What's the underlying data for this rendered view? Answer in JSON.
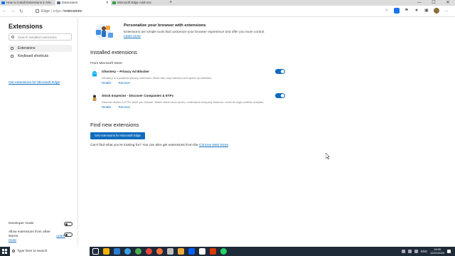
{
  "browser": {
    "tabs": [
      {
        "title": "How to install Extensions in Mic..."
      },
      {
        "title": "Extensions"
      },
      {
        "title": "Microsoft Edge Add-ons"
      }
    ],
    "new_tab_label": "+",
    "window_controls": {
      "minimize": "—",
      "maximize": "☐",
      "close": "✕"
    },
    "address": {
      "prefix": "Edge",
      "separator": "|",
      "scheme": "edge://",
      "path": "extensions"
    }
  },
  "sidebar": {
    "title": "Extensions",
    "search_placeholder": "Search installed extensions",
    "items": [
      {
        "label": "Extensions",
        "icon": "puzzle-icon",
        "active": true
      },
      {
        "label": "Keyboard shortcuts",
        "icon": "keyboard-icon",
        "active": false
      }
    ],
    "get_link": "Get extensions for Microsoft Edge",
    "developer_mode_label": "Developer mode",
    "allow_other_stores_label": "Allow extensions from other stores.",
    "learn_more": "Learn more"
  },
  "main": {
    "hero": {
      "title": "Personalize your browser with extensions",
      "description": "Extensions are simple tools that customize your browser experience and offer you more control.",
      "learn_more": "Learn more"
    },
    "installed_heading": "Installed extensions",
    "source_label": "From Microsoft Store",
    "extensions": [
      {
        "name": "Ghostery – Privacy Ad Blocker",
        "description": "Ghostery is a powerful privacy extension. Block ads, stop trackers and speed up websites.",
        "details": "Details",
        "remove": "Remove",
        "enabled": true,
        "icon": "ghost-icon"
      },
      {
        "name": "Stock Inspector - Discover Companies & ETFs",
        "description": "Discover stocks & ETFs while you browse. Watch latest stock prices, understand company finances, zoom through portfolio analysis.",
        "details": "Details",
        "remove": "Remove",
        "enabled": true,
        "icon": "inspector-icon"
      }
    ],
    "find_heading": "Find new extensions",
    "get_button": "Get extensions for Microsoft Edge",
    "cant_find_text": "Can't find what you're looking for? You can also get extensions from the",
    "chrome_store_link": "Chrome Web Store",
    "period": "."
  },
  "taskbar": {
    "search_placeholder": "Type here to search",
    "language": "ENG",
    "time": "19:55",
    "date": "12/21/2020"
  },
  "colors": {
    "accent": "#0f6cbd",
    "taskbar": "#1f2a38",
    "tabstrip": "#dcdcdc"
  }
}
